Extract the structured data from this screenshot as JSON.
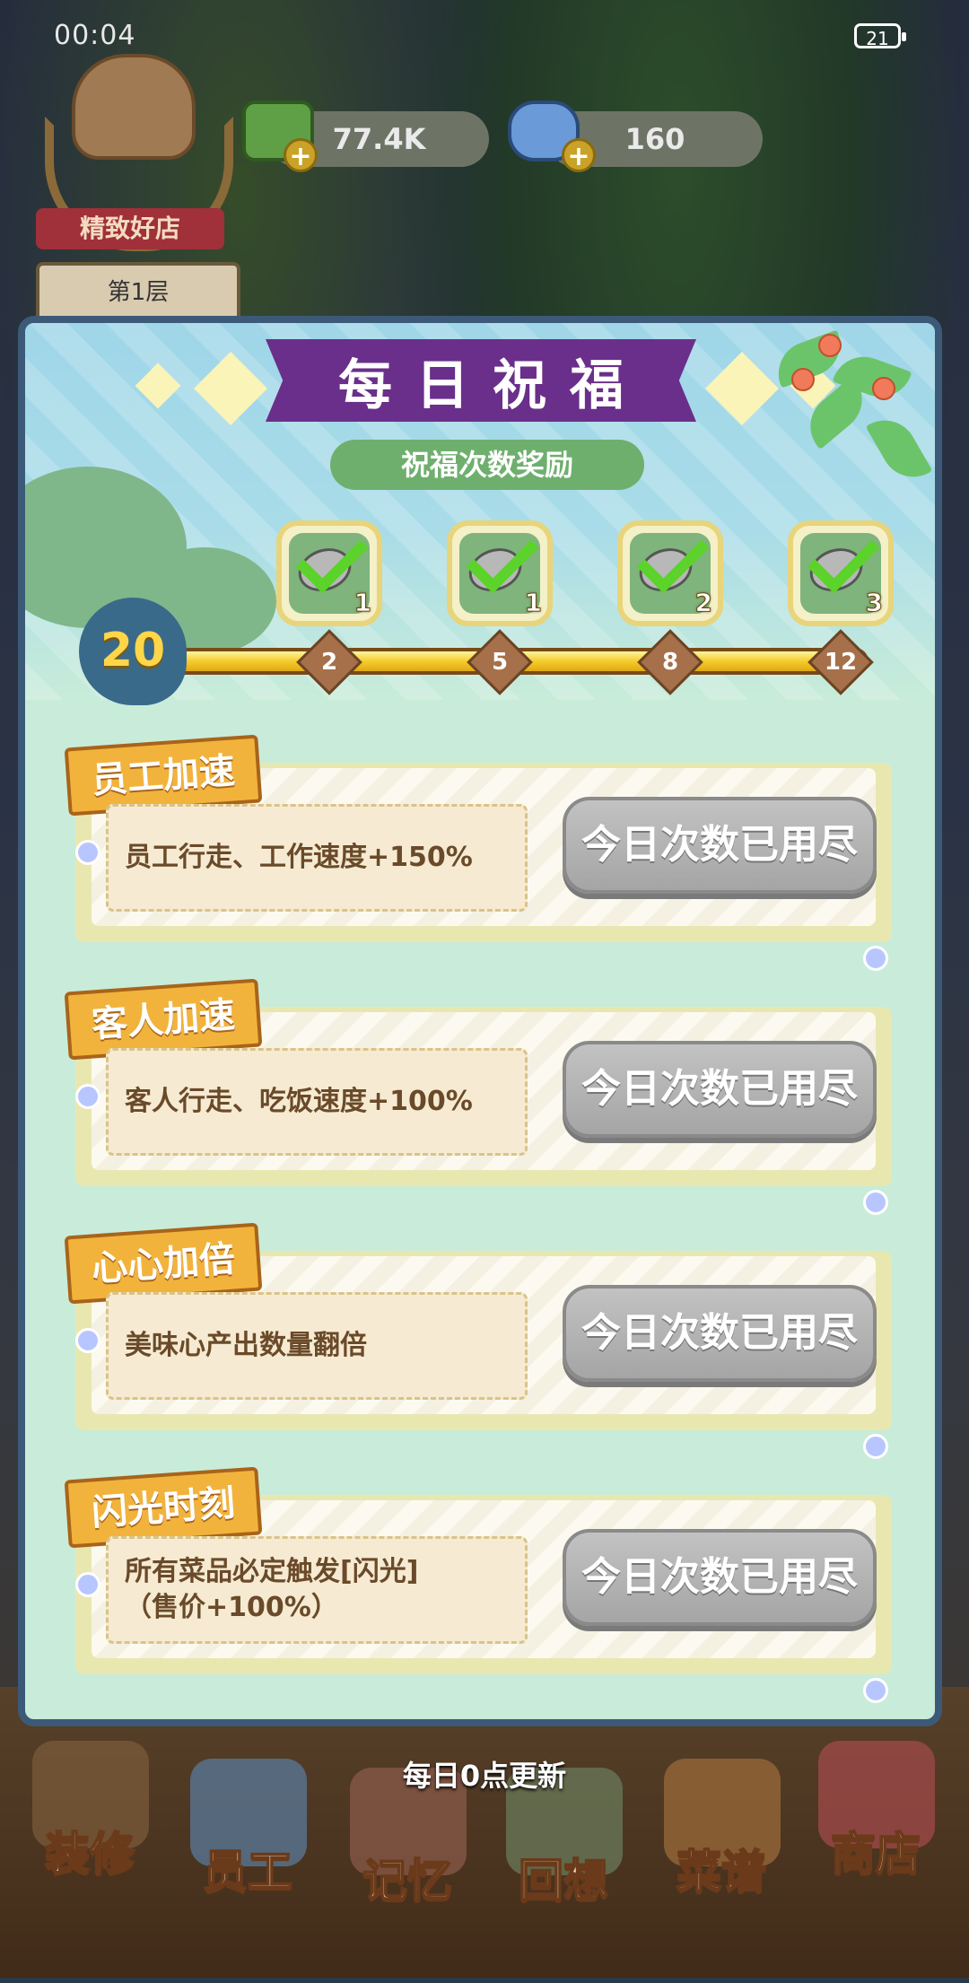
{
  "status_bar": {
    "time": "00:04",
    "battery": "21"
  },
  "shop": {
    "badge_label": "精致好店",
    "floor_label": "第1层"
  },
  "currencies": [
    {
      "name": "cash",
      "value": "77.4K",
      "color": "#6a9a4a"
    },
    {
      "name": "gem",
      "value": "160",
      "color": "#6a9ad8"
    }
  ],
  "modal": {
    "title": "每日祝福",
    "subtitle": "祝福次数奖励",
    "blessing_count": "20",
    "rewards": [
      {
        "icon": "iron-pot-icon",
        "count": "1",
        "claimed": true
      },
      {
        "icon": "cleaver-icon",
        "count": "1",
        "claimed": true
      },
      {
        "icon": "cleaver-icon",
        "count": "2",
        "claimed": true
      },
      {
        "icon": "cleaver-icon",
        "count": "3",
        "claimed": true
      }
    ],
    "milestones": [
      "2",
      "5",
      "8",
      "12"
    ],
    "progress_fraction": 1.0,
    "buffs": [
      {
        "tag": "员工加速",
        "description": "员工行走、工作速度+150%",
        "button": "今日次数已用尽"
      },
      {
        "tag": "客人加速",
        "description": "客人行走、吃饭速度+100%",
        "button": "今日次数已用尽"
      },
      {
        "tag": "心心加倍",
        "description": "美味心产出数量翻倍",
        "button": "今日次数已用尽"
      },
      {
        "tag": "闪光时刻",
        "description": "所有菜品必定触发[闪光]\n（售价+100%）",
        "button": "今日次数已用尽"
      }
    ],
    "footer": "每日0点更新"
  },
  "nav": {
    "items": [
      {
        "label": "装修",
        "icon": "hammer-icon",
        "color": "#7a5a3a"
      },
      {
        "label": "员工",
        "icon": "id-card-icon",
        "color": "#5a7a9a"
      },
      {
        "label": "记忆",
        "icon": "memory-bag-icon",
        "color": "#8a5a4a"
      },
      {
        "label": "回想",
        "icon": "bottle-icon",
        "color": "#6a7a5a"
      },
      {
        "label": "菜谱",
        "icon": "recipe-book-icon",
        "color": "#9a6a3a"
      },
      {
        "label": "商店",
        "icon": "shop-stall-icon",
        "color": "#a04a4a"
      }
    ]
  }
}
